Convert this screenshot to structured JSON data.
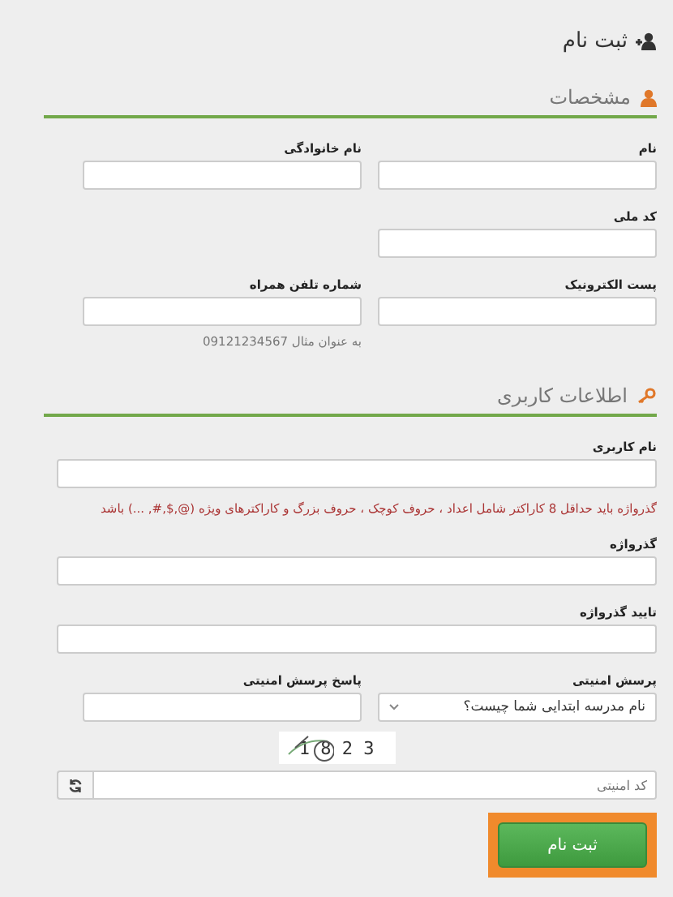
{
  "page_title": "ثبت نام",
  "sections": [
    {
      "title": "مشخصات",
      "rows": [
        {
          "kind": "pair",
          "fields": [
            {
              "kind": "text",
              "label": "نام"
            },
            {
              "kind": "text",
              "label": "نام خانوادگی"
            }
          ]
        },
        {
          "kind": "pair",
          "fields": [
            {
              "kind": "text",
              "label": "کد ملی"
            }
          ]
        },
        {
          "kind": "pair",
          "fields": [
            {
              "kind": "text",
              "label": "پست الکترونیک"
            },
            {
              "kind": "text",
              "label": "شماره تلفن همراه",
              "hint": "به عنوان مثال 09121234567"
            }
          ]
        }
      ]
    },
    {
      "title": "اطلاعات کاربری",
      "rows": [
        {
          "kind": "full",
          "fields": [
            {
              "kind": "text",
              "label": "نام کاربری"
            }
          ]
        },
        {
          "kind": "note",
          "text": "گذرواژه باید حداقل 8 کاراکتر شامل اعداد ، حروف کوچک ، حروف بزرگ و کاراکترهای ویژه (@,$,#, ...) باشد"
        },
        {
          "kind": "full",
          "fields": [
            {
              "kind": "text",
              "label": "گذرواژه"
            }
          ]
        },
        {
          "kind": "full",
          "fields": [
            {
              "kind": "text",
              "label": "تایید گذرواژه"
            }
          ]
        },
        {
          "kind": "pair",
          "fields": [
            {
              "kind": "select",
              "label": "پرسش امنیتی",
              "value": "نام مدرسه ابتدایی شما چیست؟"
            },
            {
              "kind": "text",
              "label": "پاسخ پرسش امنیتی"
            }
          ]
        }
      ]
    }
  ],
  "captcha": {
    "code": "1 8 2 3",
    "placeholder": "کد امنیتی"
  },
  "submit": {
    "label": "ثبت نام",
    "highlighted": true
  }
}
